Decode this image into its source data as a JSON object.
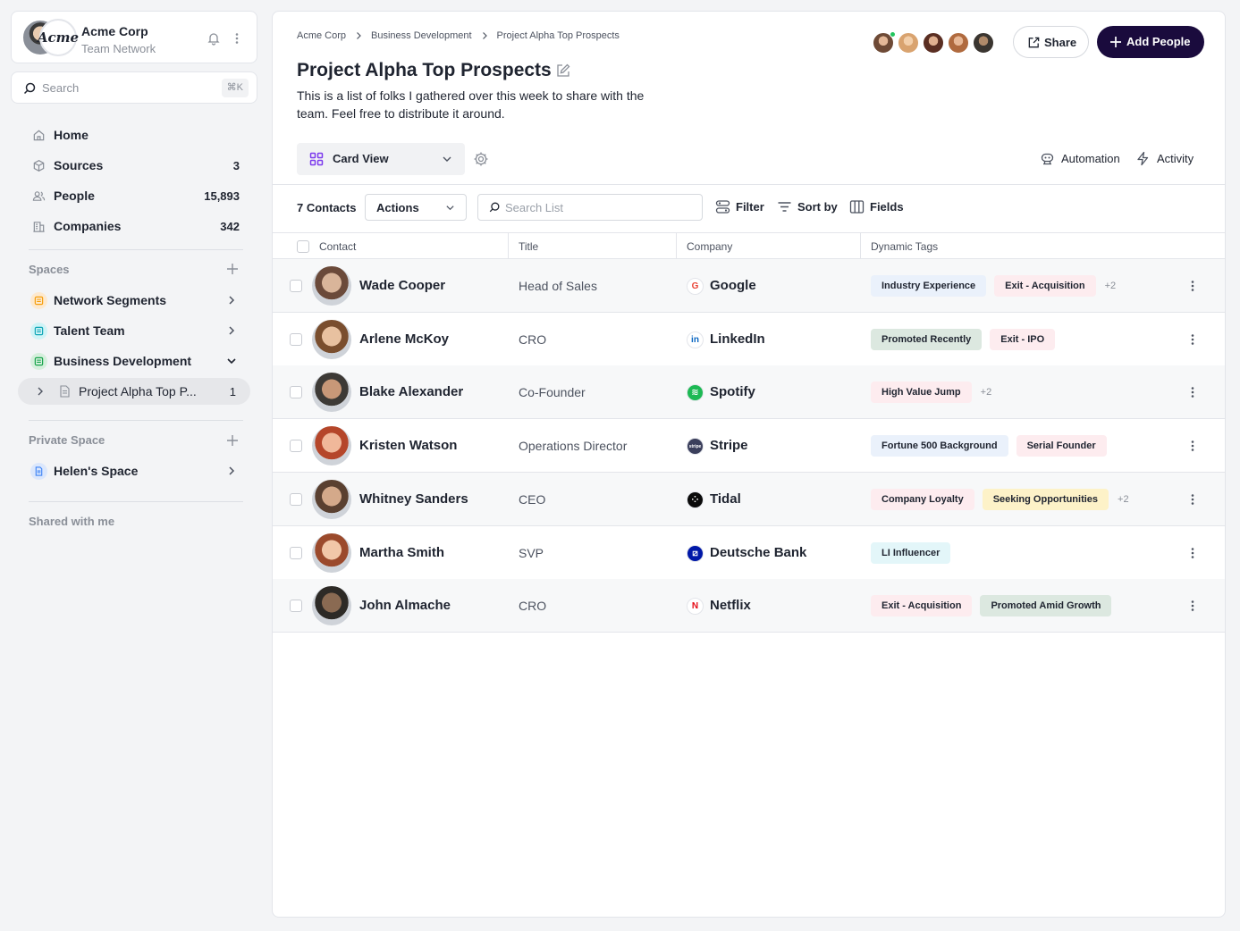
{
  "org": {
    "name": "Acme Corp",
    "subtitle": "Team Network",
    "logo_text": "Acme"
  },
  "search": {
    "placeholder": "Search",
    "shortcut": "⌘K"
  },
  "nav": [
    {
      "label": "Home",
      "count": "",
      "icon": "home-icon"
    },
    {
      "label": "Sources",
      "count": "3",
      "icon": "cube-icon"
    },
    {
      "label": "People",
      "count": "15,893",
      "icon": "people-icon"
    },
    {
      "label": "Companies",
      "count": "342",
      "icon": "building-icon"
    }
  ],
  "spaces": {
    "heading": "Spaces",
    "items": [
      {
        "label": "Network Segments",
        "color": "#f59e0b",
        "bg": "#fde9cf"
      },
      {
        "label": "Talent Team",
        "color": "#0ea5b7",
        "bg": "#cff3f6"
      },
      {
        "label": "Business Development",
        "color": "#16a34a",
        "bg": "#d5efdc"
      }
    ],
    "active_sub": {
      "label": "Project Alpha Top P...",
      "count": "1"
    }
  },
  "private_space": {
    "heading": "Private Space",
    "items": [
      {
        "label": "Helen's Space",
        "color": "#3b82f6",
        "bg": "#dbe7fc"
      }
    ]
  },
  "shared": {
    "heading": "Shared with me"
  },
  "main": {
    "breadcrumb": [
      "Acme Corp",
      "Business Development",
      "Project Alpha Top Prospects"
    ],
    "title": "Project Alpha Top Prospects",
    "description": "This is a list of folks I gathered over this week to share with the team. Feel free to distribute it around.",
    "share_label": "Share",
    "add_label": "Add People",
    "view_label": "Card View",
    "automation_label": "Automation",
    "activity_label": "Activity",
    "contacts_count": "7 Contacts",
    "actions_label": "Actions",
    "list_search_placeholder": "Search List",
    "filter_label": "Filter",
    "sort_label": "Sort by",
    "fields_label": "Fields",
    "columns": [
      "Contact",
      "Title",
      "Company",
      "Dynamic Tags"
    ]
  },
  "accent": "#1a0b3d",
  "rows": [
    {
      "name": "Wade Cooper",
      "title": "Head of Sales",
      "company": "Google",
      "logo": "G",
      "logo_fg": "#ea4335",
      "logo_bg": "#ffffff",
      "tags": [
        {
          "text": "Industry Experience",
          "bg": "#eaf1fb"
        },
        {
          "text": "Exit - Acquisition",
          "bg": "#fdecef"
        }
      ],
      "more": "+2",
      "photo": [
        "#d9b59a",
        "#6b4a3a"
      ]
    },
    {
      "name": "Arlene McKoy",
      "title": "CRO",
      "company": "LinkedIn",
      "logo": "in",
      "logo_fg": "#0a66c2",
      "logo_bg": "#ffffff",
      "tags": [
        {
          "text": "Promoted Recently",
          "bg": "#dce8e0"
        },
        {
          "text": "Exit - IPO",
          "bg": "#fdecef"
        }
      ],
      "more": "",
      "photo": [
        "#e8c1a0",
        "#7a4e2e"
      ]
    },
    {
      "name": "Blake Alexander",
      "title": "Co-Founder",
      "company": "Spotify",
      "logo": "≋",
      "logo_fg": "#ffffff",
      "logo_bg": "#1db954",
      "tags": [
        {
          "text": "High Value Jump",
          "bg": "#fdecef"
        }
      ],
      "more": "+2",
      "photo": [
        "#c89878",
        "#3d3a36"
      ]
    },
    {
      "name": "Kristen Watson",
      "title": "Operations Director",
      "company": "Stripe",
      "logo": "stripe",
      "logo_fg": "#ffffff",
      "logo_bg": "#3b3f5c",
      "tags": [
        {
          "text": "Fortune 500 Background",
          "bg": "#eaf1fb"
        },
        {
          "text": "Serial Founder",
          "bg": "#fdecef"
        }
      ],
      "more": "",
      "photo": [
        "#f0b89a",
        "#b5462a"
      ]
    },
    {
      "name": "Whitney Sanders",
      "title": "CEO",
      "company": "Tidal",
      "logo": "⁘",
      "logo_fg": "#ffffff",
      "logo_bg": "#0a0a0a",
      "tags": [
        {
          "text": "Company Loyalty",
          "bg": "#fdecef"
        },
        {
          "text": "Seeking Opportunities",
          "bg": "#fdf2c8"
        }
      ],
      "more": "+2",
      "photo": [
        "#d4a98a",
        "#5a4030"
      ]
    },
    {
      "name": "Martha Smith",
      "title": "SVP",
      "company": "Deutsche Bank",
      "logo": "⧄",
      "logo_fg": "#ffffff",
      "logo_bg": "#0018a8",
      "tags": [
        {
          "text": "LI Influencer",
          "bg": "#e3f6f9"
        }
      ],
      "more": "",
      "photo": [
        "#f1c7a8",
        "#9b4a2c"
      ]
    },
    {
      "name": "John Almache",
      "title": "CRO",
      "company": "Netflix",
      "logo": "N",
      "logo_fg": "#e50914",
      "logo_bg": "#ffffff",
      "tags": [
        {
          "text": "Exit - Acquisition",
          "bg": "#fdecef"
        },
        {
          "text": "Promoted Amid Growth",
          "bg": "#dce8e0"
        }
      ],
      "more": "",
      "photo": [
        "#8a6a52",
        "#2d2a26"
      ]
    }
  ]
}
